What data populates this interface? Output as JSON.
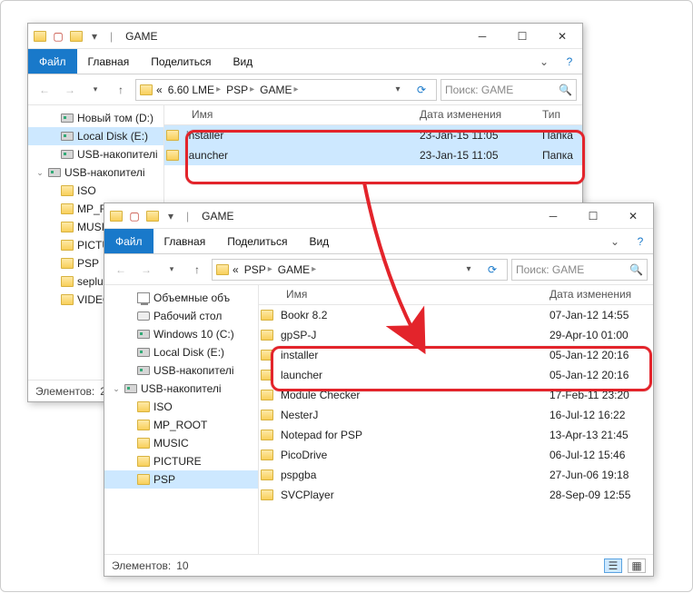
{
  "window1": {
    "title": "GAME",
    "ribbon": {
      "file": "Файл",
      "home": "Главная",
      "share": "Поделиться",
      "view": "Вид"
    },
    "breadcrumb_prefix": "«",
    "breadcrumb": [
      "6.60 LME",
      "PSP",
      "GAME"
    ],
    "search_placeholder": "Поиск: GAME",
    "tree": [
      {
        "label": "Новый том (D:)",
        "type": "drive",
        "indent": 1
      },
      {
        "label": "Local Disk (E:)",
        "type": "drive",
        "indent": 1,
        "selected": true
      },
      {
        "label": "USB-накопителі",
        "type": "drive",
        "indent": 1
      },
      {
        "label": "USB-накопителі",
        "type": "drive",
        "indent": 0,
        "expanded": true
      },
      {
        "label": "ISO",
        "type": "folder",
        "indent": 1
      },
      {
        "label": "MP_ROOT",
        "type": "folder",
        "indent": 1
      },
      {
        "label": "MUSIC",
        "type": "folder",
        "indent": 1
      },
      {
        "label": "PICTURE",
        "type": "folder",
        "indent": 1
      },
      {
        "label": "PSP",
        "type": "folder",
        "indent": 1
      },
      {
        "label": "seplugins",
        "type": "folder",
        "indent": 1
      },
      {
        "label": "VIDEO",
        "type": "folder",
        "indent": 1
      }
    ],
    "columns": {
      "name": "Имя",
      "date": "Дата изменения",
      "type": "Тип"
    },
    "rows": [
      {
        "name": "installer",
        "date": "23-Jan-15 11:05",
        "type": "Папка",
        "selected": true
      },
      {
        "name": "launcher",
        "date": "23-Jan-15 11:05",
        "type": "Папка",
        "selected": true
      }
    ],
    "status_label": "Элементов:",
    "status_count": "2"
  },
  "window2": {
    "title": "GAME",
    "ribbon": {
      "file": "Файл",
      "home": "Главная",
      "share": "Поделиться",
      "view": "Вид"
    },
    "breadcrumb_prefix": "«",
    "breadcrumb": [
      "PSP",
      "GAME"
    ],
    "search_placeholder": "Поиск: GAME",
    "tree": [
      {
        "label": "Объемные объ",
        "type": "pc",
        "indent": 1
      },
      {
        "label": "Рабочий стол",
        "type": "disk",
        "indent": 1
      },
      {
        "label": "Windows 10 (C:)",
        "type": "drive",
        "indent": 1
      },
      {
        "label": "Local Disk (E:)",
        "type": "drive",
        "indent": 1
      },
      {
        "label": "USB-накопителі",
        "type": "drive",
        "indent": 1
      },
      {
        "label": "USB-накопителі",
        "type": "drive",
        "indent": 0,
        "expanded": true
      },
      {
        "label": "ISO",
        "type": "folder",
        "indent": 1
      },
      {
        "label": "MP_ROOT",
        "type": "folder",
        "indent": 1
      },
      {
        "label": "MUSIC",
        "type": "folder",
        "indent": 1
      },
      {
        "label": "PICTURE",
        "type": "folder",
        "indent": 1
      },
      {
        "label": "PSP",
        "type": "folder",
        "indent": 1,
        "selected": true
      }
    ],
    "columns": {
      "name": "Имя",
      "date": "Дата изменения"
    },
    "rows": [
      {
        "name": "Bookr 8.2",
        "date": "07-Jan-12 14:55"
      },
      {
        "name": "gpSP-J",
        "date": "29-Apr-10 01:00"
      },
      {
        "name": "installer",
        "date": "05-Jan-12 20:16",
        "hl": true
      },
      {
        "name": "launcher",
        "date": "05-Jan-12 20:16",
        "hl": true
      },
      {
        "name": "Module Checker",
        "date": "17-Feb-11 23:20"
      },
      {
        "name": "NesterJ",
        "date": "16-Jul-12 16:22"
      },
      {
        "name": "Notepad for PSP",
        "date": "13-Apr-13 21:45"
      },
      {
        "name": "PicoDrive",
        "date": "06-Jul-12 15:46"
      },
      {
        "name": "pspgba",
        "date": "27-Jun-06 19:18"
      },
      {
        "name": "SVCPlayer",
        "date": "28-Sep-09 12:55"
      }
    ],
    "status_label": "Элементов:",
    "status_count": "10"
  }
}
